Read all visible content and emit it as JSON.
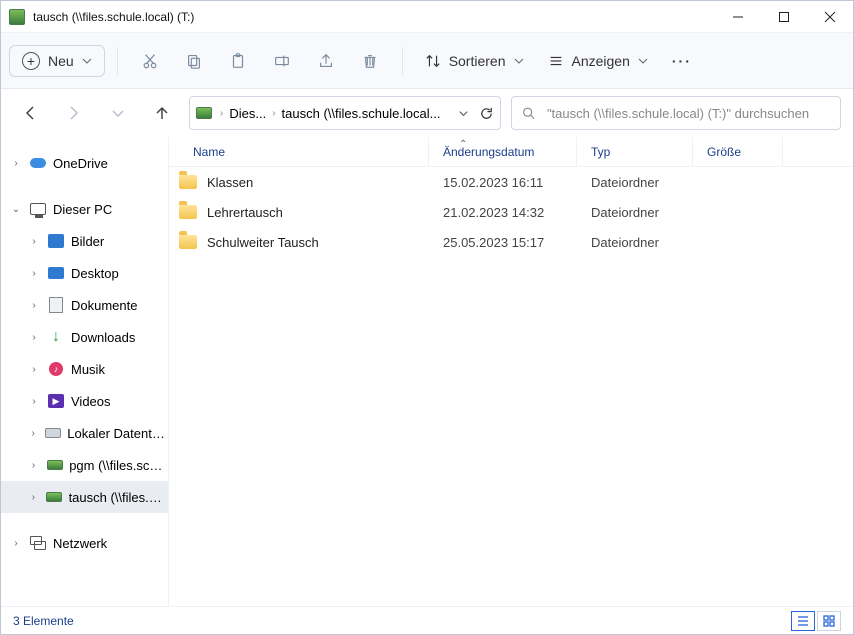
{
  "window": {
    "title": "tausch (\\\\files.schule.local) (T:)"
  },
  "toolbar": {
    "new": "Neu",
    "sort": "Sortieren",
    "view": "Anzeigen"
  },
  "breadcrumb": {
    "root": "Dies...",
    "current": "tausch (\\\\files.schule.local..."
  },
  "search": {
    "placeholder": "\"tausch (\\\\files.schule.local) (T:)\" durchsuchen"
  },
  "tree": {
    "onedrive": "OneDrive",
    "thispc": "Dieser PC",
    "pictures": "Bilder",
    "desktop": "Desktop",
    "documents": "Dokumente",
    "downloads": "Downloads",
    "music": "Musik",
    "videos": "Videos",
    "localdisk": "Lokaler Datenträger",
    "pgm": "pgm (\\\\files.schule",
    "tausch": "tausch (\\\\files.schu",
    "network": "Netzwerk"
  },
  "columns": {
    "name": "Name",
    "date": "Änderungsdatum",
    "type": "Typ",
    "size": "Größe"
  },
  "rows": [
    {
      "name": "Klassen",
      "date": "15.02.2023 16:11",
      "type": "Dateiordner"
    },
    {
      "name": "Lehrertausch",
      "date": "21.02.2023 14:32",
      "type": "Dateiordner"
    },
    {
      "name": "Schulweiter Tausch",
      "date": "25.05.2023 15:17",
      "type": "Dateiordner"
    }
  ],
  "status": {
    "count": "3 Elemente"
  }
}
